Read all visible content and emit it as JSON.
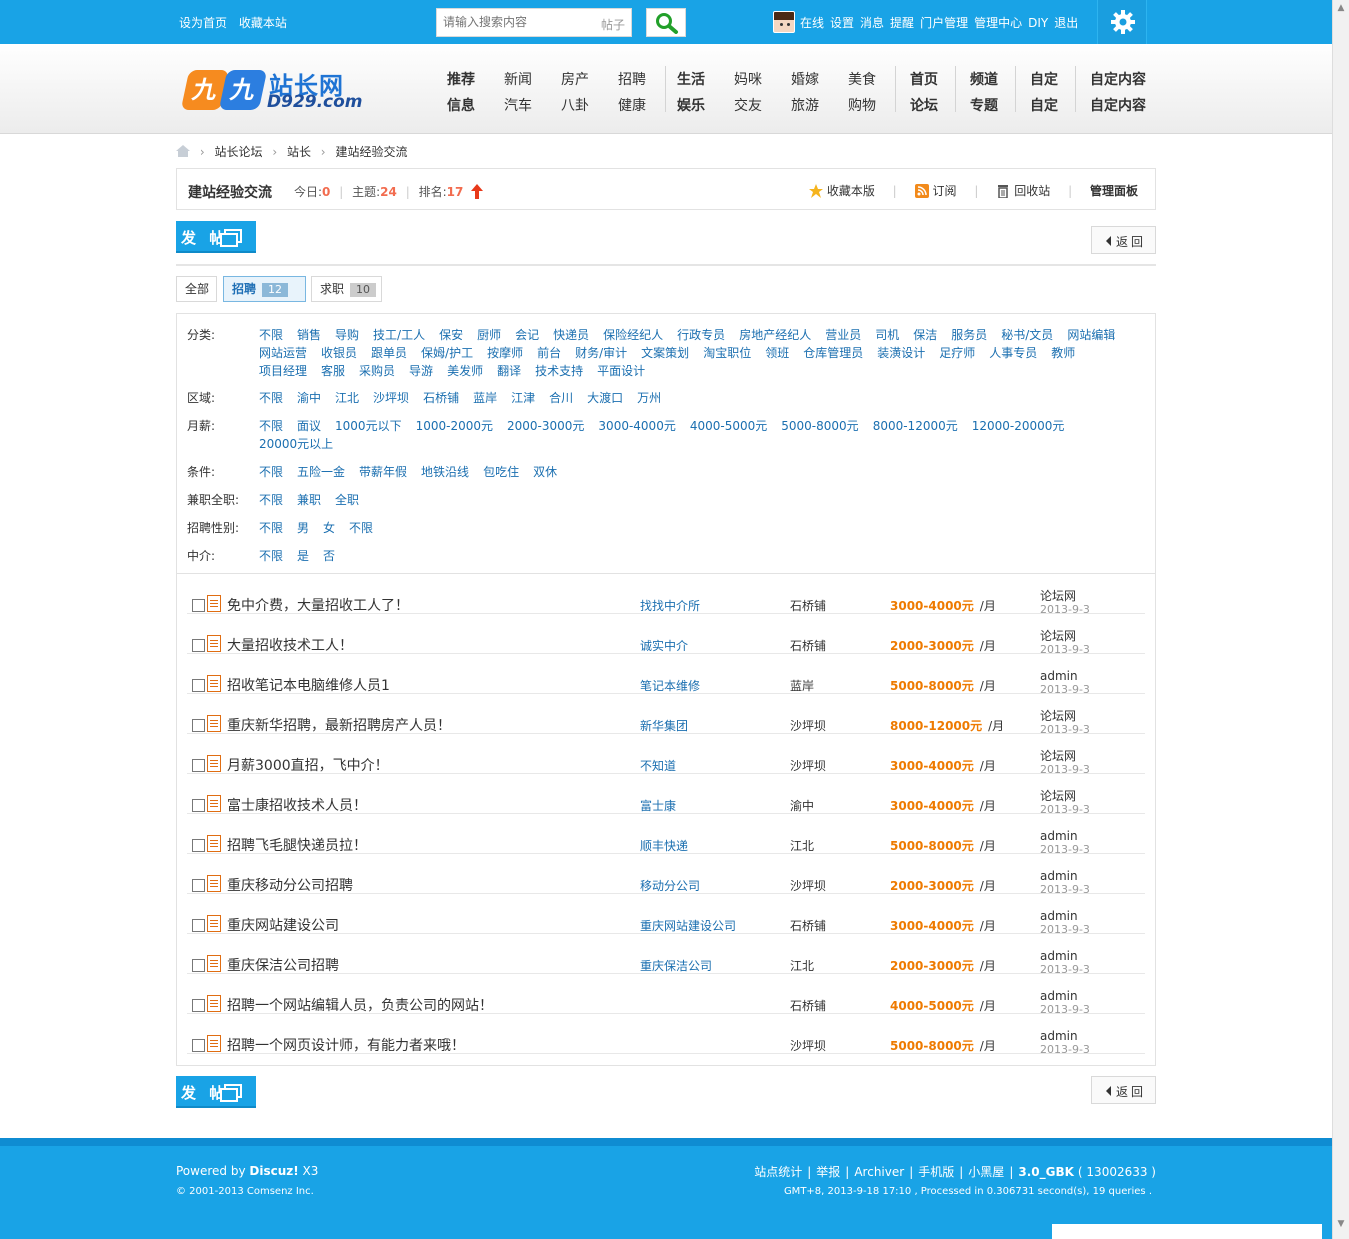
{
  "topbar": {
    "set_home": "设为首页",
    "bookmark": "收藏本站",
    "search_placeholder": "请输入搜索内容",
    "search_scope": "帖子",
    "user_links": [
      "在线",
      "设置",
      "消息",
      "提醒",
      "门户管理",
      "管理中心",
      "DIY",
      "退出"
    ]
  },
  "logo": {
    "brand": "站长网",
    "domain": "D929.com",
    "mark1": "九",
    "mark2": "九"
  },
  "mainnav": {
    "columns": [
      {
        "top": "推荐",
        "bottom": "信息",
        "bold": true
      },
      {
        "top": "新闻",
        "bottom": "汽车",
        "bold": false
      },
      {
        "top": "房产",
        "bottom": "八卦",
        "bold": false
      },
      {
        "top": "招聘",
        "bottom": "健康",
        "bold": false
      },
      {
        "top": "生活",
        "bottom": "娱乐",
        "bold": true
      },
      {
        "top": "妈咪",
        "bottom": "交友",
        "bold": false
      },
      {
        "top": "婚嫁",
        "bottom": "旅游",
        "bold": false
      },
      {
        "top": "美食",
        "bottom": "购物",
        "bold": false
      },
      {
        "top": "首页",
        "bottom": "论坛",
        "bold": true
      },
      {
        "top": "频道",
        "bottom": "专题",
        "bold": true
      },
      {
        "top": "自定",
        "bottom": "自定",
        "bold": true
      },
      {
        "top": "自定内容",
        "bottom": "自定内容",
        "bold": true
      }
    ]
  },
  "breadcrumb": [
    "站长论坛",
    "站长",
    "建站经验交流"
  ],
  "forum": {
    "title": "建站经验交流",
    "today_label": "今日:",
    "today": "0",
    "threads_label": "主题:",
    "threads": "24",
    "rank_label": "排名:",
    "rank": "17",
    "tools": {
      "favorite": "收藏本版",
      "subscribe": "订阅",
      "recycle": "回收站",
      "manage": "管理面板"
    }
  },
  "buttons": {
    "post": "发 帖",
    "back": "返回"
  },
  "tabs": [
    {
      "label": "全部",
      "count": ""
    },
    {
      "label": "招聘",
      "count": "12"
    },
    {
      "label": "求职",
      "count": "10"
    }
  ],
  "filters": [
    {
      "label": "分类:",
      "options": [
        "不限",
        "销售",
        "导购",
        "技工/工人",
        "保安",
        "厨师",
        "会记",
        "快递员",
        "保险经纪人",
        "行政专员",
        "房地产经纪人",
        "营业员",
        "司机",
        "保洁",
        "服务员",
        "秘书/文员",
        "网站编辑",
        "网站运营",
        "收银员",
        "跟单员",
        "保姆/护工",
        "按摩师",
        "前台",
        "财务/审计",
        "文案策划",
        "淘宝职位",
        "领班",
        "仓库管理员",
        "装潢设计",
        "足疗师",
        "人事专员",
        "教师",
        "项目经理",
        "客服",
        "采购员",
        "导游",
        "美发师",
        "翻译",
        "技术支持",
        "平面设计"
      ]
    },
    {
      "label": "区域:",
      "options": [
        "不限",
        "渝中",
        "江北",
        "沙坪坝",
        "石桥铺",
        "蓝岸",
        "江津",
        "合川",
        "大渡口",
        "万州"
      ]
    },
    {
      "label": "月薪:",
      "options": [
        "不限",
        "面议",
        "1000元以下",
        "1000-2000元",
        "2000-3000元",
        "3000-4000元",
        "4000-5000元",
        "5000-8000元",
        "8000-12000元",
        "12000-20000元",
        "20000元以上"
      ]
    },
    {
      "label": "条件:",
      "options": [
        "不限",
        "五险一金",
        "带薪年假",
        "地铁沿线",
        "包吃住",
        "双休"
      ]
    },
    {
      "label": "兼职全职:",
      "options": [
        "不限",
        "兼职",
        "全职"
      ]
    },
    {
      "label": "招聘性别:",
      "options": [
        "不限",
        "男",
        "女",
        "不限"
      ]
    },
    {
      "label": "中介:",
      "options": [
        "不限",
        "是",
        "否"
      ]
    }
  ],
  "threads": [
    {
      "subject": "免中介费，大量招收工人了！",
      "company": "找找中介所",
      "area": "石桥铺",
      "salary": "3000-4000元",
      "unit": "/月",
      "author": "论坛网",
      "date": "2013-9-3"
    },
    {
      "subject": "大量招收技术工人！",
      "company": "诚实中介",
      "area": "石桥铺",
      "salary": "2000-3000元",
      "unit": "/月",
      "author": "论坛网",
      "date": "2013-9-3"
    },
    {
      "subject": "招收笔记本电脑维修人员1",
      "company": "笔记本维修",
      "area": "蓝岸",
      "salary": "5000-8000元",
      "unit": "/月",
      "author": "admin",
      "date": "2013-9-3"
    },
    {
      "subject": "重庆新华招聘，最新招聘房产人员！",
      "company": "新华集团",
      "area": "沙坪坝",
      "salary": "8000-12000元",
      "unit": "/月",
      "author": "论坛网",
      "date": "2013-9-3"
    },
    {
      "subject": "月薪3000直招，飞中介！",
      "company": "不知道",
      "area": "沙坪坝",
      "salary": "3000-4000元",
      "unit": "/月",
      "author": "论坛网",
      "date": "2013-9-3"
    },
    {
      "subject": "富士康招收技术人员！",
      "company": "富士康",
      "area": "渝中",
      "salary": "3000-4000元",
      "unit": "/月",
      "author": "论坛网",
      "date": "2013-9-3"
    },
    {
      "subject": "招聘飞毛腿快递员拉！",
      "company": "顺丰快递",
      "area": "江北",
      "salary": "5000-8000元",
      "unit": "/月",
      "author": "admin",
      "date": "2013-9-3"
    },
    {
      "subject": "重庆移动分公司招聘",
      "company": "移动分公司",
      "area": "沙坪坝",
      "salary": "2000-3000元",
      "unit": "/月",
      "author": "admin",
      "date": "2013-9-3"
    },
    {
      "subject": "重庆网站建设公司",
      "company": "重庆网站建设公司",
      "area": "石桥铺",
      "salary": "3000-4000元",
      "unit": "/月",
      "author": "admin",
      "date": "2013-9-3"
    },
    {
      "subject": "重庆保洁公司招聘",
      "company": "重庆保洁公司",
      "area": "江北",
      "salary": "2000-3000元",
      "unit": "/月",
      "author": "admin",
      "date": "2013-9-3"
    },
    {
      "subject": "招聘一个网站编辑人员，负责公司的网站！",
      "company": "",
      "area": "石桥铺",
      "salary": "4000-5000元",
      "unit": "/月",
      "author": "admin",
      "date": "2013-9-3"
    },
    {
      "subject": "招聘一个网页设计师，有能力者来哦！",
      "company": "",
      "area": "沙坪坝",
      "salary": "5000-8000元",
      "unit": "/月",
      "author": "admin",
      "date": "2013-9-3"
    }
  ],
  "footer": {
    "powered_prefix": "Powered by ",
    "powered_brand": "Discuz!",
    "powered_version": " X3",
    "copyright": "© 2001-2013 Comsenz Inc.",
    "links": [
      "站点统计",
      "举报",
      "Archiver",
      "手机版",
      "小黑屋"
    ],
    "version_code": "3.0_GBK",
    "version_num": "( 13002633 )",
    "gmt": "GMT+8, 2013-9-18 17:10 , Processed in 0.306731 second(s), 19 queries ."
  },
  "colors": {
    "accent": "#19a3e6",
    "salary": "#ee7a00",
    "link": "#1b6fb0",
    "stat": "#f26c4f"
  }
}
